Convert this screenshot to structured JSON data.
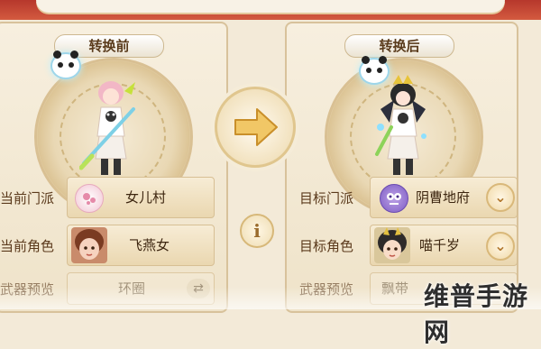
{
  "before": {
    "title": "转换前",
    "sect_label": "当前门派",
    "sect_value": "女儿村",
    "role_label": "当前角色",
    "role_value": "飞燕女",
    "weapon_label": "武器预览",
    "weapon_value": "环圈"
  },
  "after": {
    "title": "转换后",
    "sect_label": "目标门派",
    "sect_value": "阴曹地府",
    "role_label": "目标角色",
    "role_value": "喵千岁",
    "weapon_label": "武器预览",
    "weapon_value": "飘带"
  },
  "info_symbol": "i",
  "watermark": "维普手游网",
  "icons": {
    "arrow": "right-arrow-icon",
    "info": "info-icon",
    "dropdown": "chevron-down-icon",
    "swap": "swap-arrows-icon"
  },
  "colors": {
    "accent": "#d9b87a",
    "panel": "#f3ead8",
    "header_red": "#c24432"
  }
}
